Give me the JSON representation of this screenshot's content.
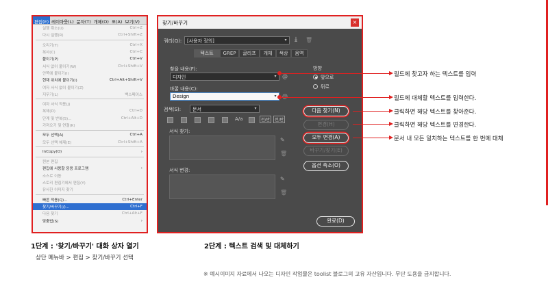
{
  "menu": {
    "bar": [
      "편집(E)",
      "레이아웃(L)",
      "문자(T)",
      "개체(O)",
      "표(A)",
      "보기(V)"
    ],
    "items": [
      {
        "label": "실행 취소(U)",
        "shortcut": "Ctrl+Z",
        "dim": true
      },
      {
        "label": "다시 실행(R)",
        "shortcut": "Ctrl+Shift+Z",
        "dim": true
      },
      {
        "sep": true
      },
      {
        "label": "오리기(T)",
        "shortcut": "Ctrl+X",
        "dim": true
      },
      {
        "label": "복사(C)",
        "shortcut": "Ctrl+C",
        "dim": true
      },
      {
        "label": "붙이기(P)",
        "shortcut": "Ctrl+V"
      },
      {
        "label": "서식 없이 붙이기(W)",
        "shortcut": "Ctrl+Shift+V",
        "dim": true
      },
      {
        "label": "안쪽에 붙이기(I)",
        "shortcut": "",
        "dim": true
      },
      {
        "label": "현재 위치에 붙이기(I)",
        "shortcut": "Ctrl+Alt+Shift+V"
      },
      {
        "label": "여자 서식 없이 붙이기(Z)",
        "shortcut": "",
        "dim": true
      },
      {
        "label": "지우기(L)",
        "shortcut": "백스페이스",
        "dim": true
      },
      {
        "sep": true
      },
      {
        "label": "여자 서식 적용(J)",
        "shortcut": "",
        "dim": true
      },
      {
        "label": "복제(D)",
        "shortcut": "Ctrl+D",
        "dim": true
      },
      {
        "label": "단계 및 반복(S)...",
        "shortcut": "Ctrl+Alt+D",
        "dim": true
      },
      {
        "label": "가져오기 및 연결(K)",
        "shortcut": "",
        "dim": true
      },
      {
        "sep": true
      },
      {
        "label": "모두 선택(A)",
        "shortcut": "Ctrl+A"
      },
      {
        "label": "모두 선택 해제(E)",
        "shortcut": "Ctrl+Shift+A",
        "dim": true
      },
      {
        "sep": true
      },
      {
        "label": "InCopy(O)",
        "shortcut": "›"
      },
      {
        "sep": true
      },
      {
        "label": "원본 편집",
        "shortcut": "",
        "dim": true
      },
      {
        "label": "편집에 사용할 응용 프로그램",
        "shortcut": "›"
      },
      {
        "label": "소스로 이동",
        "shortcut": "",
        "dim": true
      },
      {
        "label": "스토리 편집기에서 편집(Y)",
        "shortcut": "",
        "dim": true
      },
      {
        "label": "유사한 이미지 찾기",
        "shortcut": "",
        "dim": true
      },
      {
        "sep": true
      },
      {
        "label": "빠른 적용(Q)...",
        "shortcut": "Ctrl+Enter"
      },
      {
        "label": "찾기/바꾸기(/)...",
        "shortcut": "Ctrl+F",
        "highlight": true
      },
      {
        "label": "다음 찾기",
        "shortcut": "Ctrl+Alt+F",
        "dim": true
      },
      {
        "label": "맞춤법(S)",
        "shortcut": "›"
      }
    ]
  },
  "dialog": {
    "title": "찾기/바꾸기",
    "close": "×",
    "query_label": "쿼리(Q):",
    "query_value": "[사용자 정의]",
    "tabs": [
      "텍스트",
      "GREP",
      "글리프",
      "개체",
      "색상",
      "음역"
    ],
    "find_label": "찾을 내용(F):",
    "find_value": "디자인",
    "replace_label": "바꿀 내용(C):",
    "replace_value": "Design",
    "search_label": "검색(S):",
    "search_value": "문서",
    "direction_label": "방향",
    "direction_forward": "앞으로",
    "direction_backward": "뒤로",
    "case_label": "A/a",
    "half_label": "전/반",
    "find_format_label": "서식 찾기:",
    "change_format_label": "서식 변경:",
    "buttons": {
      "find_next": "다음 찾기(N)",
      "change": "변경(H)",
      "change_all": "모두 변경(A)",
      "change_find": "바꾸기/찾기(E)",
      "fewer_options": "옵션 축소(O)",
      "done": "완료(D)"
    }
  },
  "hints": [
    "필드에 찾고자 하는 텍스트를 입력",
    "필드에 대체할 텍스트를 입력한다.",
    "클릭하면 해당 텍스트를 찾아준다.",
    "클릭하면 해당 텍스트를 변경한다.",
    "문서 내 모든 일치하는 텍스트를 한 번에 대체"
  ],
  "captions": {
    "step1_title": "1단계 : '찾기/바꾸기' 대화 상자 열기",
    "step1_sub": "상단 메뉴바 > 편집 > 찾기/바꾸기 선택",
    "step2_title": "2단계 : 텍스트 검색 및 대체하기"
  },
  "footnote": "※   예시이미지 자료에서 나오는 디자인 작업물은 toolist 블로그의 고유 자산입니다. 무단 도용을 금지합니다.",
  "colors": {
    "accent": "#e02020",
    "menu_highlight": "#2f6fd0",
    "dialog_bg": "#4a4a4a"
  }
}
